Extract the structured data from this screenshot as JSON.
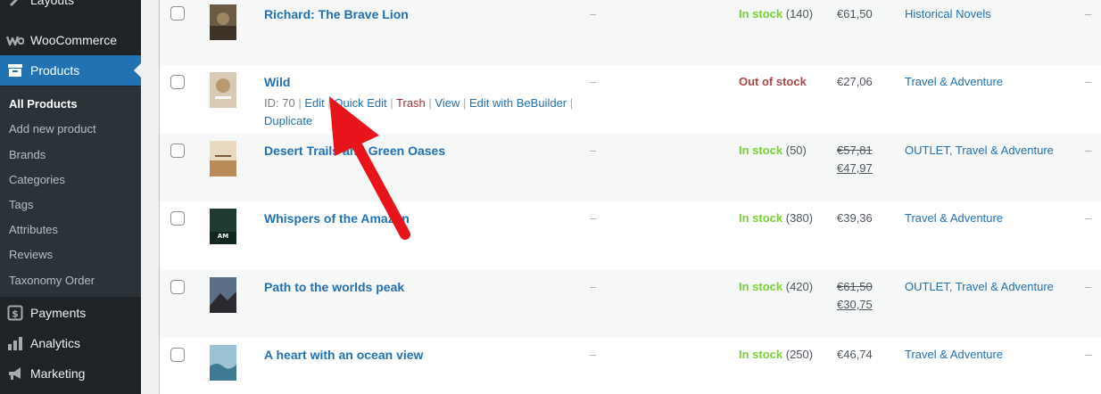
{
  "sidebar": {
    "items": [
      {
        "label": "Layouts",
        "icon": "layouts-icon"
      },
      {
        "label": "WooCommerce",
        "icon": "woocommerce-icon"
      },
      {
        "label": "Products",
        "icon": "archive-icon"
      },
      {
        "label": "Payments",
        "icon": "payments-icon"
      },
      {
        "label": "Analytics",
        "icon": "analytics-icon"
      },
      {
        "label": "Marketing",
        "icon": "megaphone-icon"
      }
    ],
    "submenu": [
      "All Products",
      "Add new product",
      "Brands",
      "Categories",
      "Tags",
      "Attributes",
      "Reviews",
      "Taxonomy Order"
    ]
  },
  "row_actions": {
    "id_label": "ID: 70",
    "edit": "Edit",
    "quick_edit": "Quick Edit",
    "trash": "Trash",
    "view": "View",
    "edit_bebuilder": "Edit with BeBuilder",
    "duplicate": "Duplicate",
    "sep": "|"
  },
  "products": [
    {
      "name": "Richard: The Brave Lion",
      "sku": "–",
      "stock_status": "In stock",
      "stock_qty": "(140)",
      "price": "€61,50",
      "categories": "Historical Novels",
      "tags": "–"
    },
    {
      "name": "Wild",
      "sku": "–",
      "stock_status": "Out of stock",
      "stock_qty": "",
      "price": "€27,06",
      "categories": "Travel & Adventure",
      "tags": "–"
    },
    {
      "name": "Desert Trails and Green Oases",
      "sku": "–",
      "stock_status": "In stock",
      "stock_qty": "(50)",
      "price_regular": "€57,81",
      "price_sale": "€47,97",
      "categories": "OUTLET, Travel & Adventure",
      "tags": "–"
    },
    {
      "name": "Whispers of the Amazon",
      "sku": "–",
      "stock_status": "In stock",
      "stock_qty": "(380)",
      "price": "€39,36",
      "categories": "Travel & Adventure",
      "tags": "–"
    },
    {
      "name": "Path to the worlds peak",
      "sku": "–",
      "stock_status": "In stock",
      "stock_qty": "(420)",
      "price_regular": "€61,50",
      "price_sale": "€30,75",
      "categories": "OUTLET, Travel & Adventure",
      "tags": "–"
    },
    {
      "name": "A heart with an ocean view",
      "sku": "–",
      "stock_status": "In stock",
      "stock_qty": "(250)",
      "price": "€46,74",
      "categories": "Travel & Adventure",
      "tags": "–"
    }
  ],
  "colors": {
    "sidebar_bg": "#1d2327",
    "active_menu": "#2271b1",
    "link": "#2271b1",
    "in_stock": "#7ad03a",
    "out_of_stock": "#aa4444",
    "annotation_arrow": "#e8141b"
  }
}
